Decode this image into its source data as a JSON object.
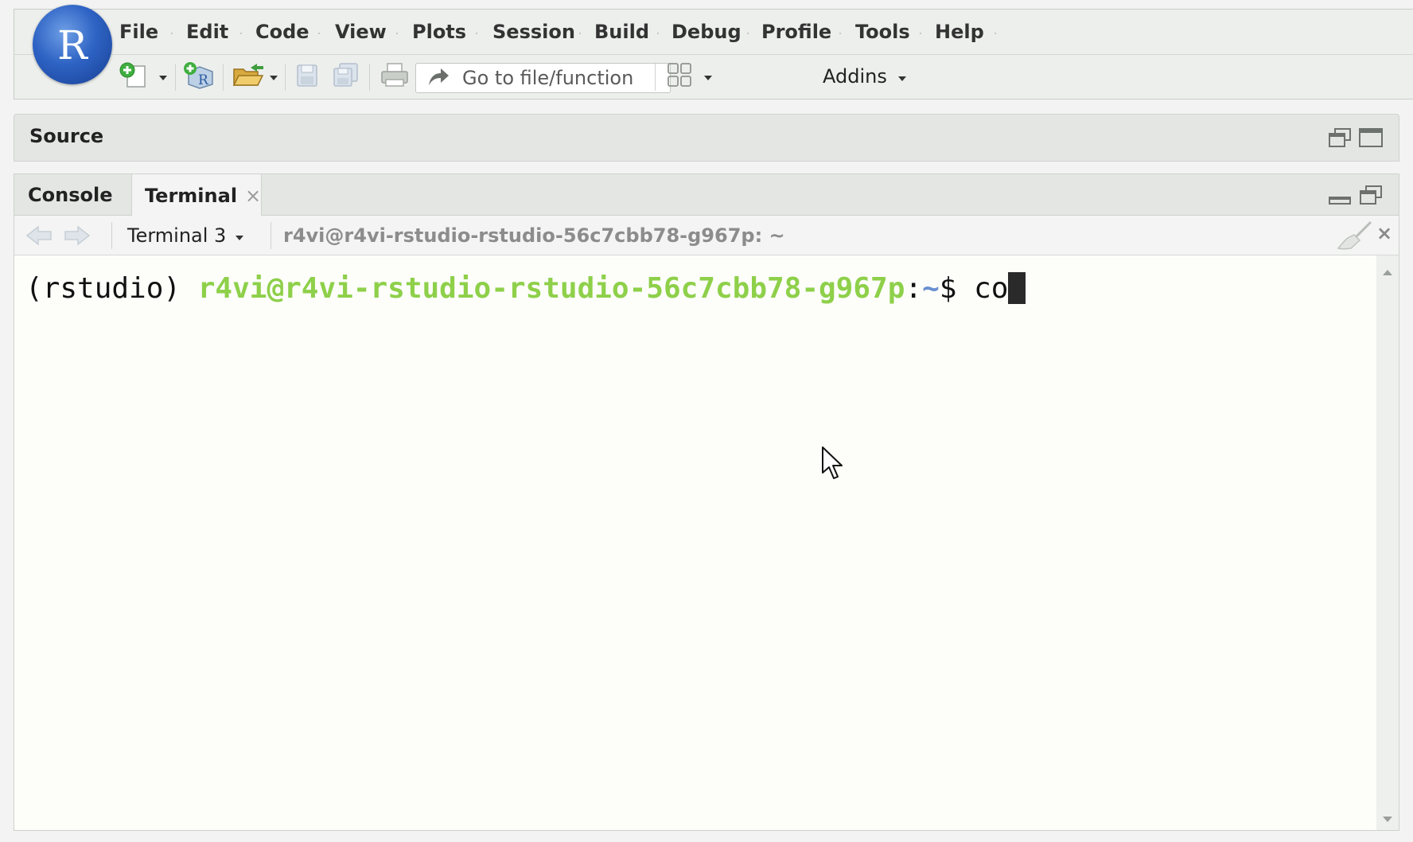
{
  "app": {
    "logo_letter": "R"
  },
  "menu": {
    "items": [
      "File",
      "Edit",
      "Code",
      "View",
      "Plots",
      "Session",
      "Build",
      "Debug",
      "Profile",
      "Tools",
      "Help"
    ]
  },
  "toolbar": {
    "goto_placeholder": "Go to file/function",
    "addins_label": "Addins",
    "icons": [
      "new-file-icon",
      "new-project-icon",
      "open-file-icon",
      "save-icon",
      "save-all-icon",
      "print-icon",
      "goto-arrow-icon",
      "pane-layout-icon"
    ]
  },
  "source_pane": {
    "title": "Source"
  },
  "console_pane": {
    "tabs": [
      {
        "label": "Console",
        "active": false
      },
      {
        "label": "Terminal",
        "active": true,
        "closable": true
      }
    ],
    "close_symbol": "×",
    "terminal_selector": "Terminal 3",
    "terminal_path": "r4vi@r4vi-rstudio-rstudio-56c7cbb78-g967p: ~"
  },
  "terminal": {
    "env_prefix": "(rstudio) ",
    "user_host": "r4vi@r4vi-rstudio-rstudio-56c7cbb78-g967p",
    "colon": ":",
    "cwd": "~",
    "prompt_symbol": "$ ",
    "typed_text": "co"
  },
  "colors": {
    "prompt_user": "#8ed04a",
    "prompt_path": "#6a8fd1",
    "terminal_bg": "#fdfdfa"
  }
}
